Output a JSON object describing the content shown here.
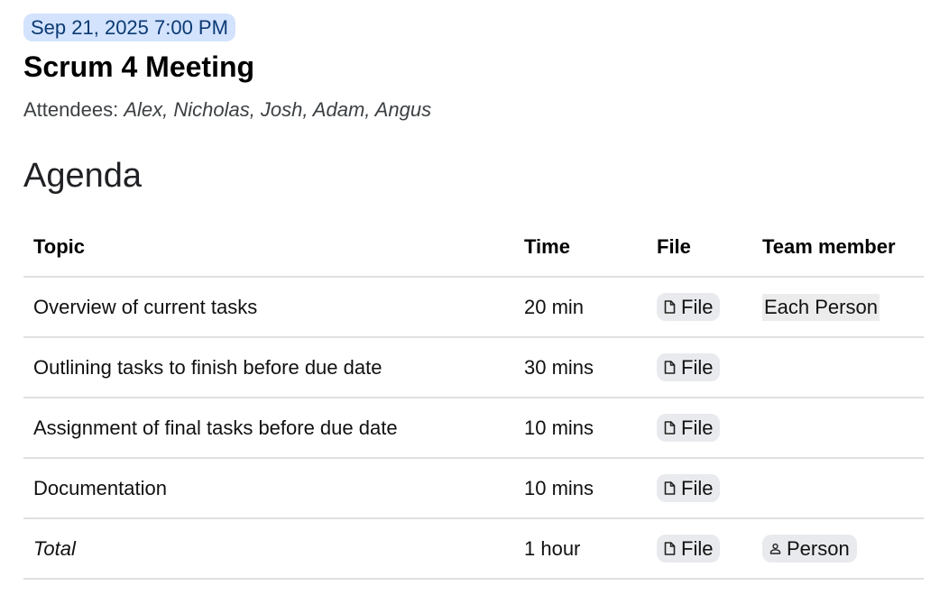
{
  "meeting": {
    "date": "Sep 21, 2025 7:00 PM",
    "title": "Scrum 4 Meeting",
    "attendees_label": "Attendees: ",
    "attendees": "Alex, Nicholas, Josh, Adam, Angus"
  },
  "agenda": {
    "heading": "Agenda",
    "columns": [
      "Topic",
      "Time",
      "File",
      "Team member"
    ],
    "rows": [
      {
        "topic": "Overview of current tasks",
        "time": "20 min",
        "file": "File",
        "member": "Each Person"
      },
      {
        "topic": "Outlining tasks to finish before due date",
        "time": "30 mins",
        "file": "File",
        "member": ""
      },
      {
        "topic": "Assignment of final tasks before due date",
        "time": "10 mins",
        "file": "File",
        "member": ""
      },
      {
        "topic": "Documentation",
        "time": "10 mins",
        "file": "File",
        "member": ""
      },
      {
        "topic": "Total",
        "time": "1 hour",
        "file": "File",
        "member": "Person"
      }
    ]
  },
  "icons": {
    "file_chip": "file-icon",
    "person_chip": "person-icon"
  },
  "colors": {
    "date_chip_bg": "#d3e3fd",
    "date_chip_text": "#0b3a73",
    "chip_bg": "#e8eaed"
  }
}
